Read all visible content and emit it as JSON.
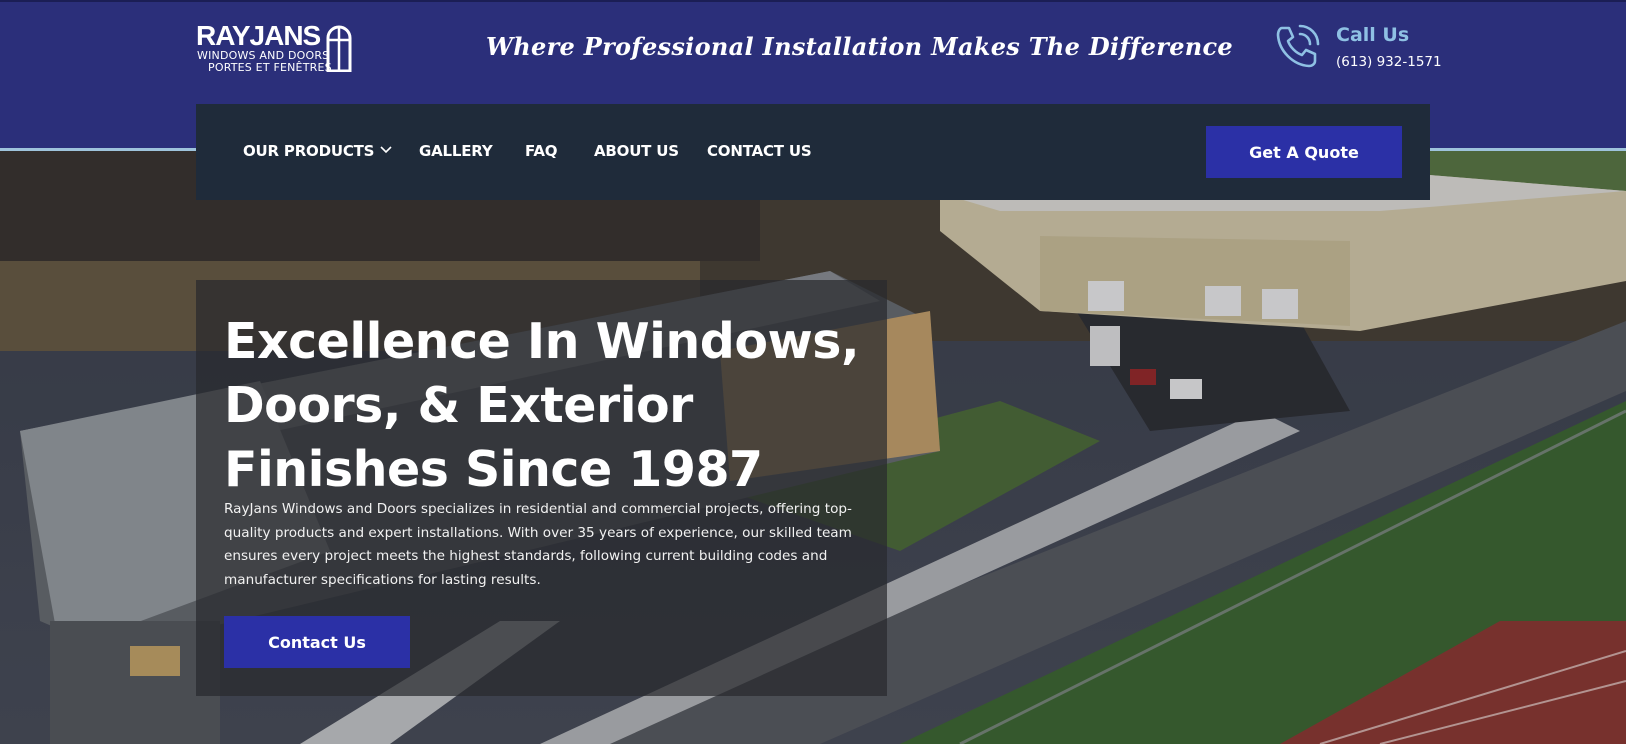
{
  "header": {
    "logo": {
      "brand": "RAYJANS",
      "line1": "WINDOWS AND DOORS",
      "line2": "PORTES ET FENÊTRES"
    },
    "tagline": "Where Professional Installation Makes The Difference",
    "call": {
      "title": "Call Us",
      "number": "(613) 932-1571",
      "icon": "phone-icon"
    }
  },
  "nav": {
    "items": [
      {
        "label": "OUR PRODUCTS",
        "has_dropdown": true
      },
      {
        "label": "GALLERY"
      },
      {
        "label": "FAQ"
      },
      {
        "label": "ABOUT US"
      },
      {
        "label": "CONTACT US"
      }
    ],
    "quote_button": "Get A Quote"
  },
  "hero": {
    "title_lines": [
      "Excellence In Windows,",
      "Doors, & Exterior",
      "Finishes Since 1987"
    ],
    "description": "RayJans Windows and Doors specializes in residential and commercial projects, offering top-quality products and expert installations. With over 35 years of experience, our skilled team ensures every project meets the highest standards, following current building codes and manufacturer specifications for lasting results.",
    "cta": "Contact Us"
  },
  "colors": {
    "header_bg": "#2b2f7a",
    "nav_bg": "#1f2b3a",
    "button_bg": "#2b30a6",
    "call_accent": "#8fc1e4"
  }
}
